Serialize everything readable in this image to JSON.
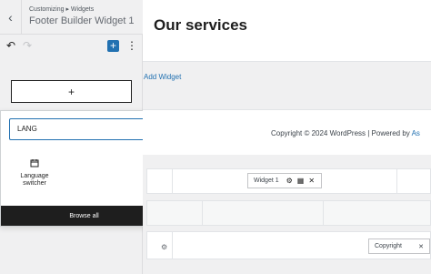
{
  "panel": {
    "breadcrumb": "Customizing ▸ Widgets",
    "title": "Footer Builder Widget 1",
    "back_icon": "‹",
    "undo_icon": "↶",
    "redo_icon": "↷",
    "add_icon": "+",
    "more_icon": "⋮",
    "appender_icon": "+"
  },
  "inserter": {
    "search_value": "LANG",
    "clear_icon": "✕",
    "results": [
      {
        "label": "Language switcher",
        "icon": "calendar-icon"
      }
    ],
    "browse_all": "Browse all"
  },
  "preview": {
    "heading": "Our services",
    "add_widget": "Add Widget",
    "copyright_text": "Copyright © 2024 WordPress | Powered by ",
    "copyright_link": "As",
    "widget_chip": "Widget 1",
    "copyright_chip": "Copyright",
    "chip_close": "✕",
    "settings_icon": "⚙",
    "columns_icon": "▦"
  },
  "colors": {
    "accent": "#2271b1",
    "dark": "#1e1e1e",
    "panel_bg": "#f0f0f1"
  }
}
